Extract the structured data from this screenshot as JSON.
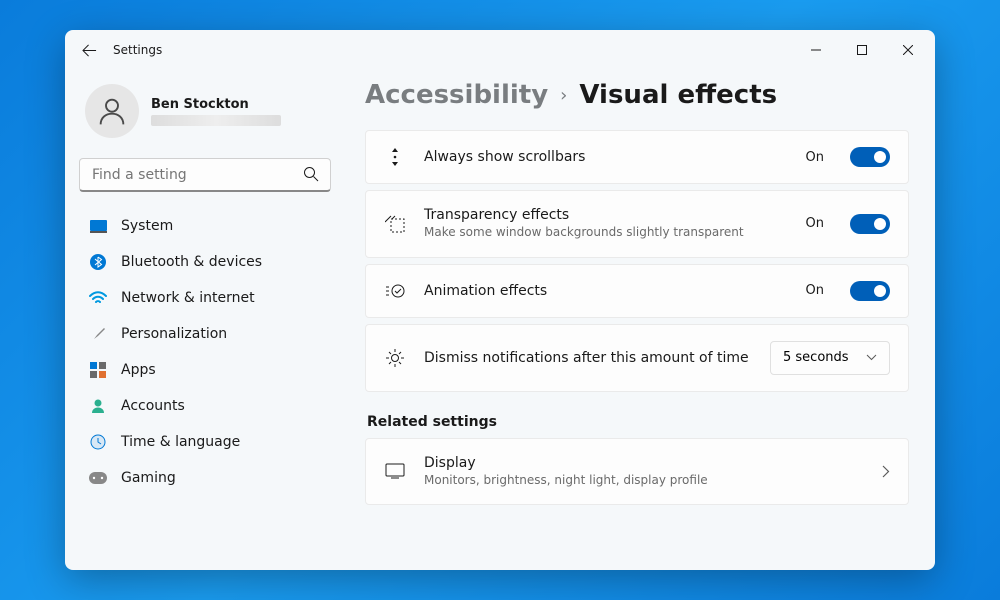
{
  "app_title": "Settings",
  "user": {
    "name": "Ben Stockton"
  },
  "search": {
    "placeholder": "Find a setting"
  },
  "nav": {
    "items": [
      {
        "label": "System",
        "icon": "system-icon"
      },
      {
        "label": "Bluetooth & devices",
        "icon": "bluetooth-icon"
      },
      {
        "label": "Network & internet",
        "icon": "wifi-icon"
      },
      {
        "label": "Personalization",
        "icon": "brush-icon"
      },
      {
        "label": "Apps",
        "icon": "apps-icon"
      },
      {
        "label": "Accounts",
        "icon": "accounts-icon"
      },
      {
        "label": "Time & language",
        "icon": "time-icon"
      },
      {
        "label": "Gaming",
        "icon": "gaming-icon"
      }
    ]
  },
  "breadcrumb": {
    "parent": "Accessibility",
    "current": "Visual effects"
  },
  "settings": {
    "scrollbars": {
      "title": "Always show scrollbars",
      "state": "On",
      "on": true
    },
    "transparency": {
      "title": "Transparency effects",
      "sub": "Make some window backgrounds slightly transparent",
      "state": "On",
      "on": true
    },
    "animation": {
      "title": "Animation effects",
      "state": "On",
      "on": true
    },
    "dismiss": {
      "title": "Dismiss notifications after this amount of time",
      "value": "5 seconds"
    }
  },
  "related": {
    "heading": "Related settings",
    "display": {
      "title": "Display",
      "sub": "Monitors, brightness, night light, display profile"
    }
  }
}
